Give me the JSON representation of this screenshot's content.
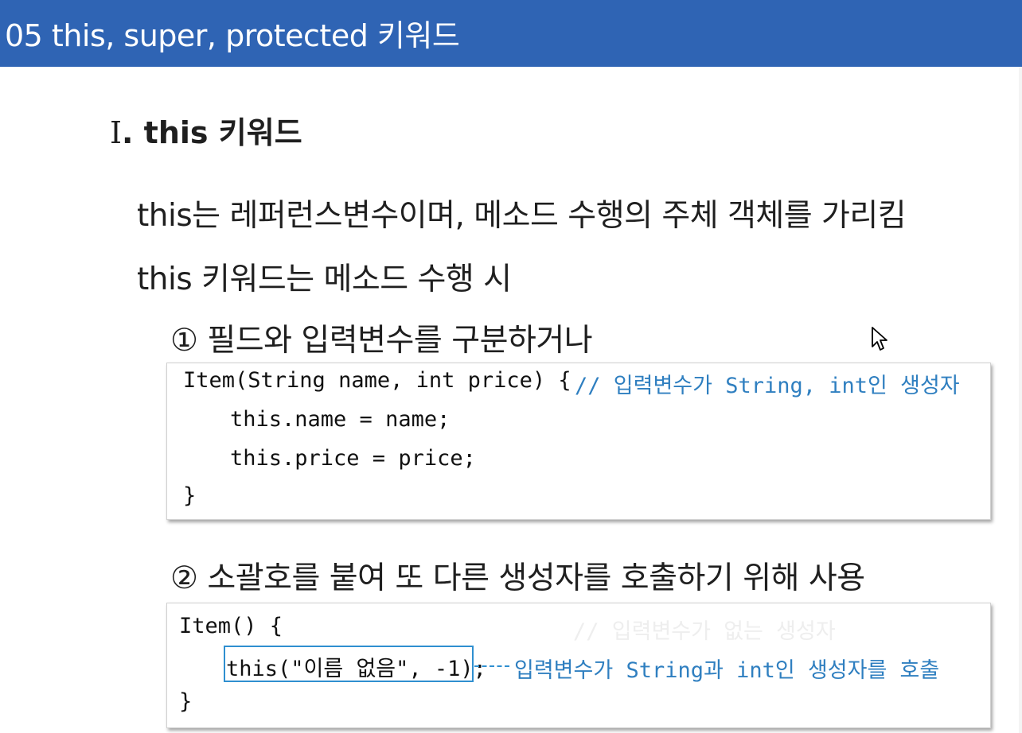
{
  "header": {
    "title": "05 this, super, protected 키워드",
    "background_color": "#2f64b4"
  },
  "section": {
    "numeral": "Ⅰ",
    "title": ". this 키워드"
  },
  "body": {
    "line1": "this는 레퍼런스변수이며, 메소드 수행의 주체 객체를 가리킴",
    "line2": "this 키워드는 메소드 수행 시"
  },
  "item1": {
    "text": "① 필드와 입력변수를 구분하거나",
    "code": {
      "line1": "Item(String name, int price) {",
      "comment": "// 입력변수가 String, int인 생성자",
      "line2": "this.name = name;",
      "line3": "this.price = price;",
      "line4": "}"
    }
  },
  "item2": {
    "text": "② 소괄호를 붙여 또 다른 생성자를 호출하기 위해 사용",
    "code": {
      "line1": "Item() {",
      "comment_faded": "// 입력변수가 없는 생성자",
      "line2": "this(\"이름 없음\", -1);",
      "annotation": "입력변수가 String과 int인 생성자를 호출",
      "line3": "}"
    }
  },
  "colors": {
    "accent": "#2f7fc0",
    "highlight": "#2f8fd0"
  },
  "icons": {
    "cursor": "mouse-pointer-icon"
  }
}
